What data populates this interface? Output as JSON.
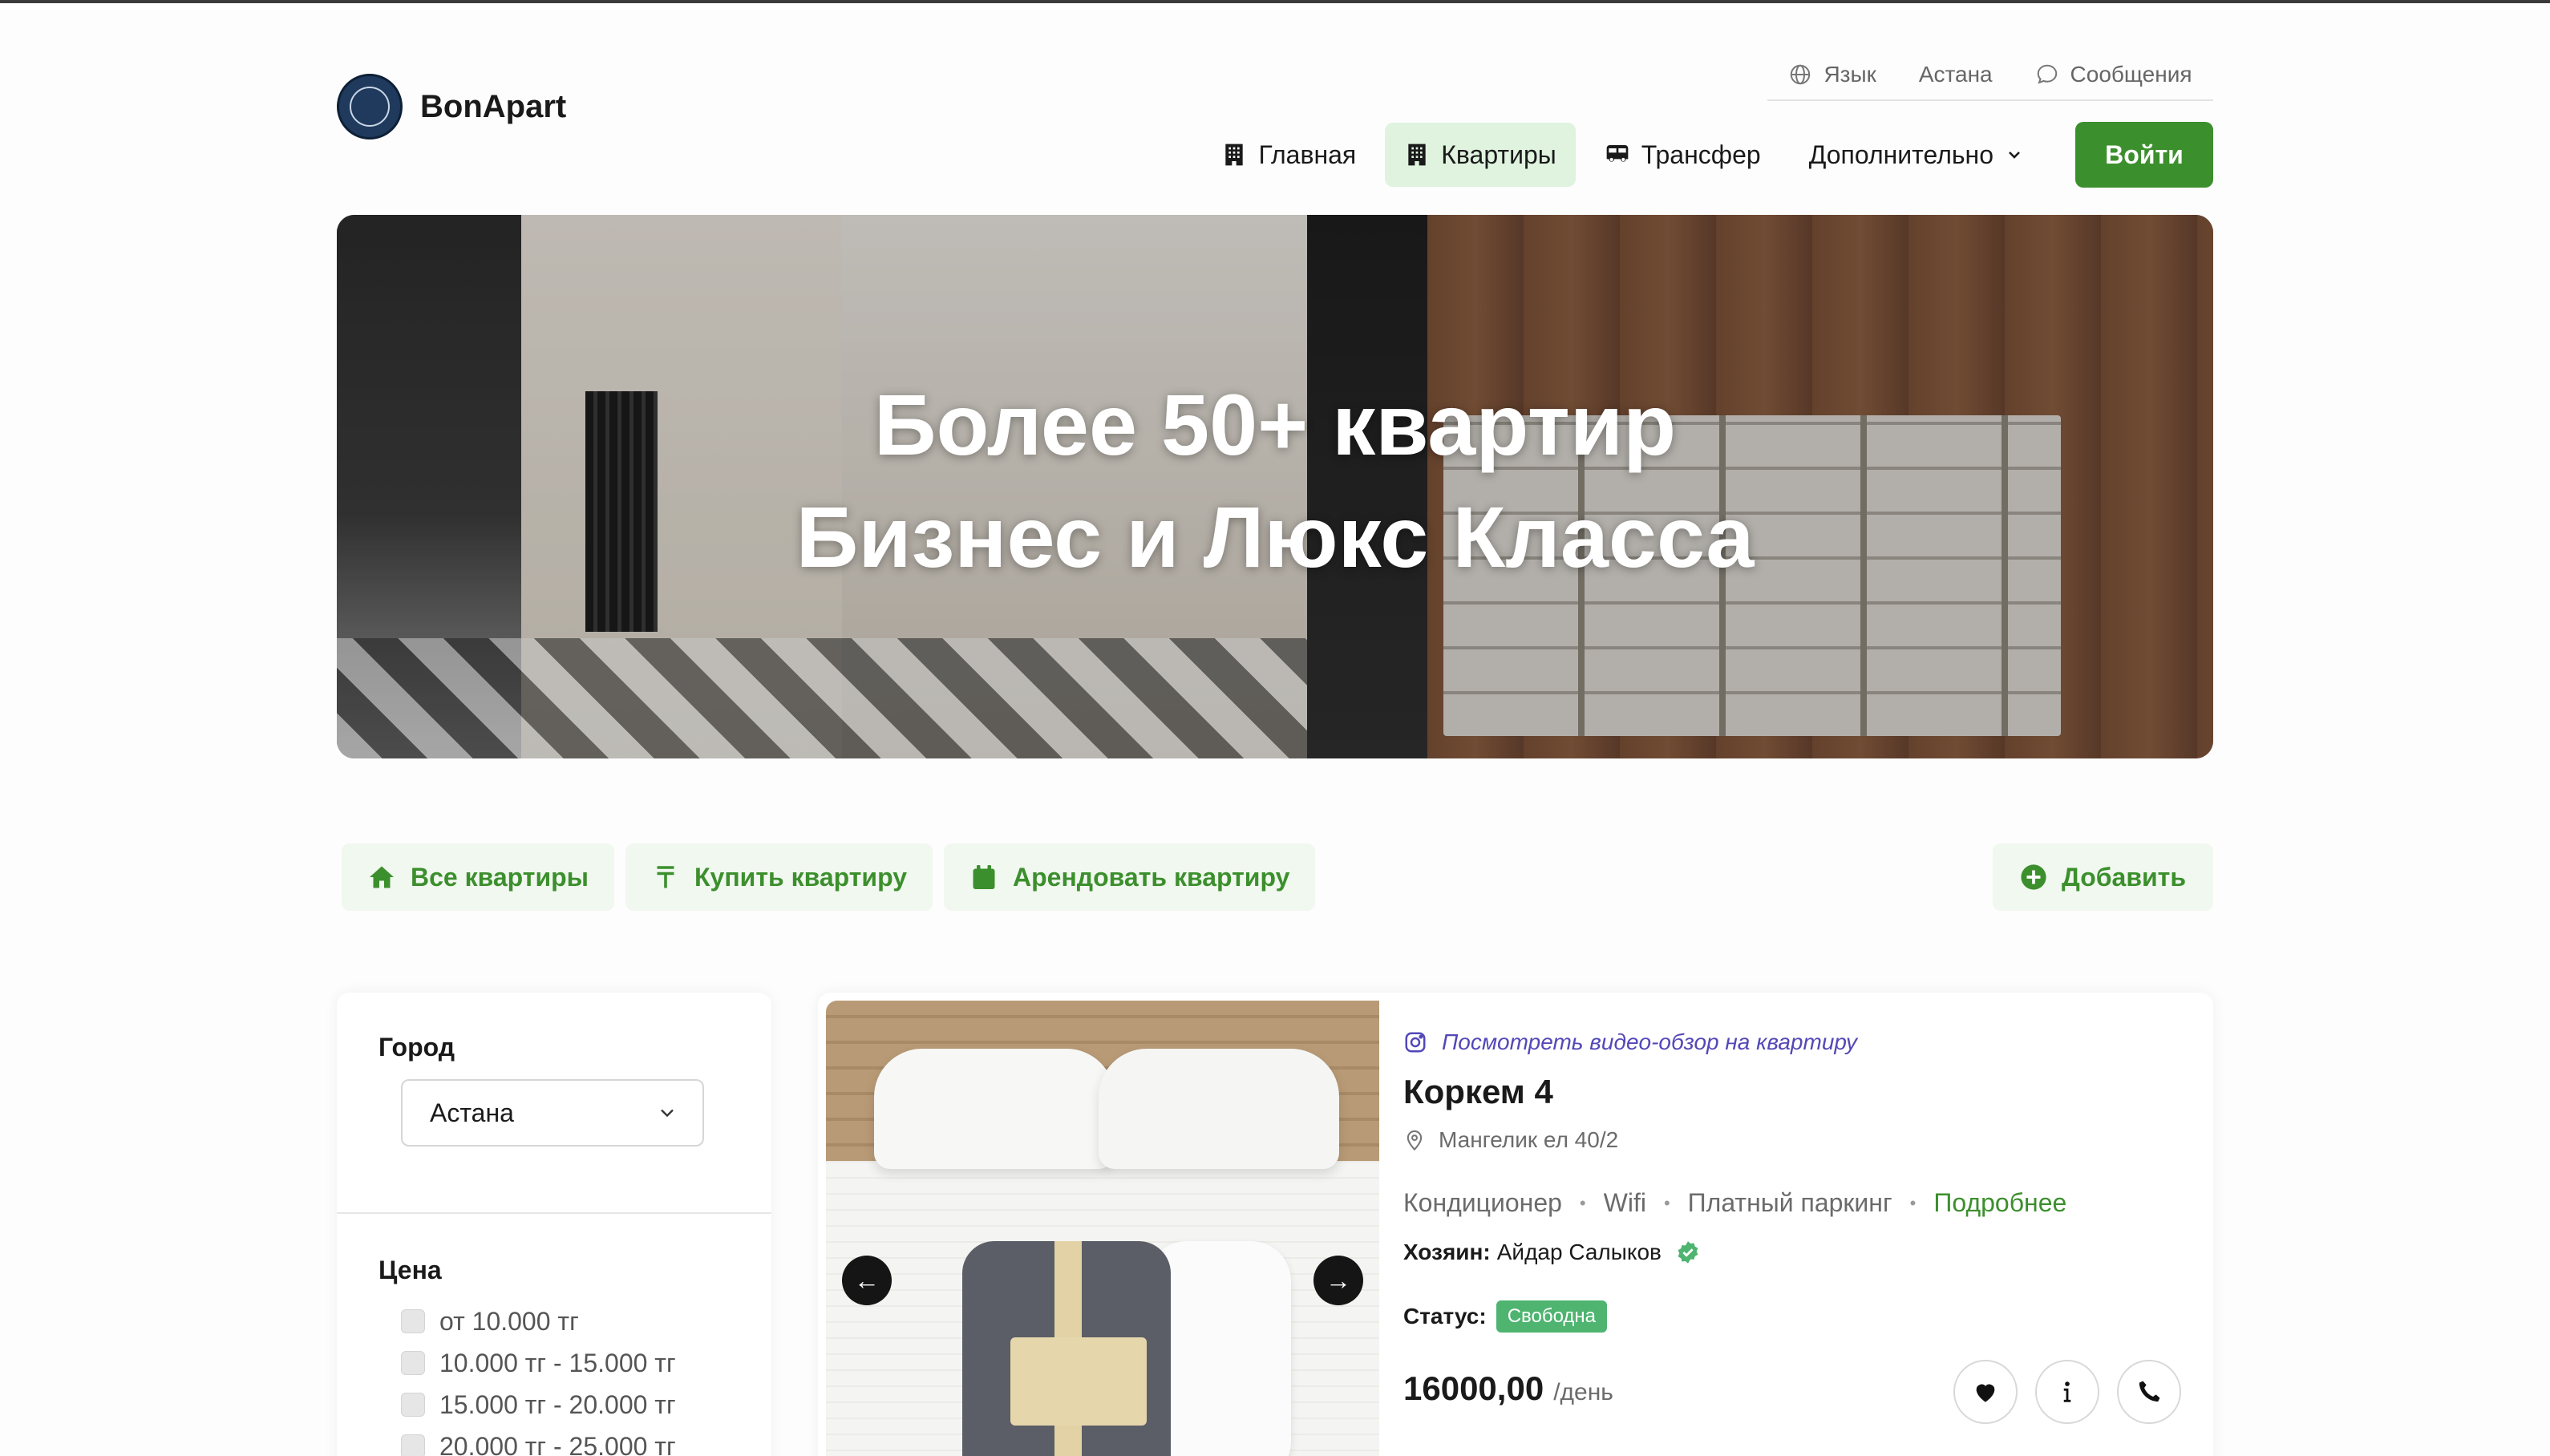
{
  "brand": {
    "name": "BonApart",
    "logo_icon": "bonapart-logo"
  },
  "topbar": {
    "language_label": "Язык",
    "city_label": "Астана",
    "messages_label": "Сообщения"
  },
  "nav": {
    "items": [
      {
        "label": "Главная",
        "icon": "building-icon",
        "active": false
      },
      {
        "label": "Квартиры",
        "icon": "building-icon",
        "active": true
      },
      {
        "label": "Трансфер",
        "icon": "bus-icon",
        "active": false
      },
      {
        "label": "Дополнительно",
        "icon": "chevron-down-icon",
        "active": false
      }
    ],
    "login_label": "Войти"
  },
  "hero": {
    "line1": "Более 50+ квартир",
    "line2": "Бизнес и Люкс Класса"
  },
  "filters": {
    "all_label": "Все квартиры",
    "buy_label": "Купить квартиру",
    "rent_label": "Арендовать квартиру",
    "add_label": "Добавить"
  },
  "sidebar": {
    "city_heading": "Город",
    "city_selected": "Астана",
    "price_heading": "Цена",
    "price_options": [
      "от 10.000 тг",
      "10.000 тг - 15.000 тг",
      "15.000 тг - 20.000 тг",
      "20.000 тг - 25.000 тг"
    ]
  },
  "listing": {
    "video_link": "Посмотреть видео-обзор на квартиру",
    "title": "Коркем 4",
    "address": "Мангелик ел 40/2",
    "amenities": [
      "Кондиционер",
      "Wifi",
      "Платный паркинг"
    ],
    "more_label": "Подробнее",
    "owner_label": "Хозяин:",
    "owner_name": "Айдар Салыков",
    "status_label": "Статус:",
    "status_value": "Свободна",
    "price": "16000,00",
    "price_unit": "/день",
    "prev_arrow": "←",
    "next_arrow": "→"
  },
  "colors": {
    "brand_green": "#3c8f2d",
    "active_nav_bg": "#dff3df",
    "status_green": "#4eb46f",
    "video_link": "#5348b8"
  }
}
